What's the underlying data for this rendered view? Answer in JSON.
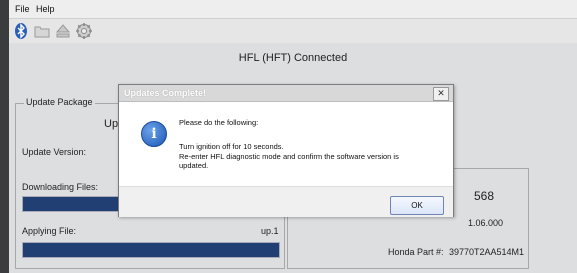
{
  "menu": [
    "File",
    "Help"
  ],
  "toolbar": {
    "icons": [
      "bluetooth-icon",
      "folder-icon",
      "eject-icon",
      "gear-icon"
    ]
  },
  "header": {
    "status": "HFL (HFT) Connected"
  },
  "update_package": {
    "title": "Update Package",
    "partial_label": "Upc",
    "update_version_label": "Update Version:",
    "downloading_label": "Downloading Files:",
    "applying_label": "Applying File:",
    "applying_value": "up.1"
  },
  "right_panel": {
    "partial_number": "568",
    "version_value": "1.06.000",
    "part_label": "Honda Part #:",
    "part_value": "39770T2AA514M1"
  },
  "dialog": {
    "title": "Updates Complete!",
    "close": "✕",
    "line1": "Please do the following:",
    "line2": "Turn ignition off for 10 seconds.",
    "line3": "Re-enter HFL diagnostic mode and confirm the software version is",
    "line4": "updated.",
    "ok": "OK",
    "icon_glyph": "i"
  }
}
